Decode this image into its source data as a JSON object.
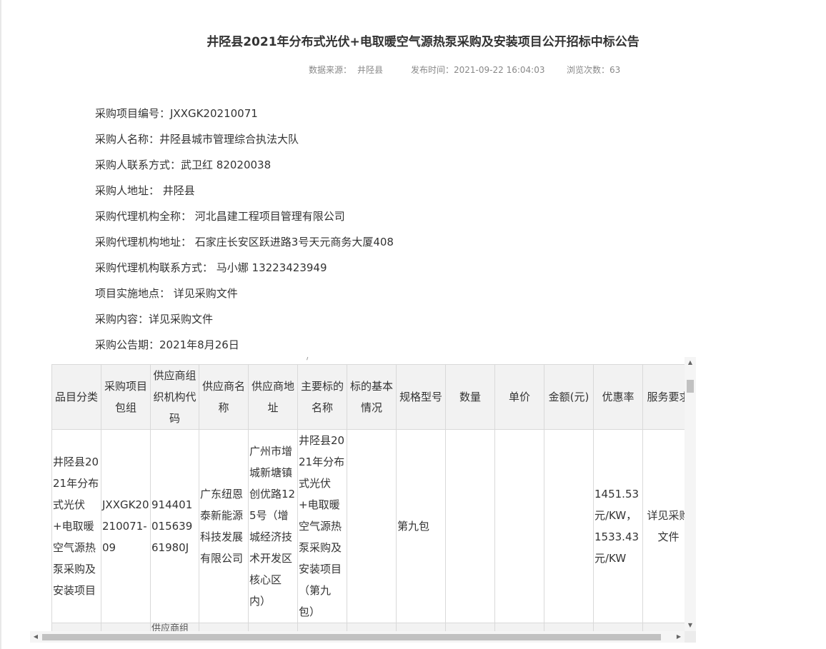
{
  "page": {
    "title": "井陉县2021年分布式光伏+电取暖空气源热泵采购及安装项目公开招标中标公告"
  },
  "meta": {
    "source_label": "数据来源：",
    "source_value": "井陉县",
    "publish_label": "发布时间：",
    "publish_value": "2021-09-22 16:04:03",
    "views_label": "浏览次数：",
    "views_value": "63"
  },
  "fields": [
    "采购项目编号：JXXGK20210071",
    "采购人名称：井陉县城市管理综合执法大队",
    "采购人联系方式：武卫红 82020038",
    "采购人地址： 井陉县",
    "采购代理机构全称： 河北昌建工程项目管理有限公司",
    "采购代理机构地址： 石家庄长安区跃进路3号天元商务大厦408",
    "采购代理机构联系方式： 马小娜 13223423949",
    "项目实施地点： 详见采购文件",
    "采购内容：详见采购文件",
    "采购公告期：2021年8月26日"
  ],
  "table": {
    "cut_glyph": "/",
    "headers": [
      "品目分类",
      "采购项目包组",
      "供应商组织机构代码",
      "供应商名称",
      "供应商地址",
      "主要标的名称",
      "标的基本情况",
      "规格型号",
      "数量",
      "单价",
      "金额(元)",
      "优惠率",
      "服务要求"
    ],
    "row": [
      "井陉县2021年分布式光伏+电取暖空气源热泵采购及安装项目",
      "JXXGK20210071-09",
      "91440101563961980J",
      "广东纽恩泰新能源科技发展有限公司",
      "广州市增城新塘镇创优路125号（增城经济技术开发区核心区内）",
      "井陉县2021年分布式光伏+电取暖空气源热泵采购及安装项目（第九包）",
      "",
      "第九包",
      "",
      "",
      "",
      "1451.53元/KW，1533.43元/KW",
      "详见采购文件"
    ],
    "next_row_partial": "供应商组"
  }
}
